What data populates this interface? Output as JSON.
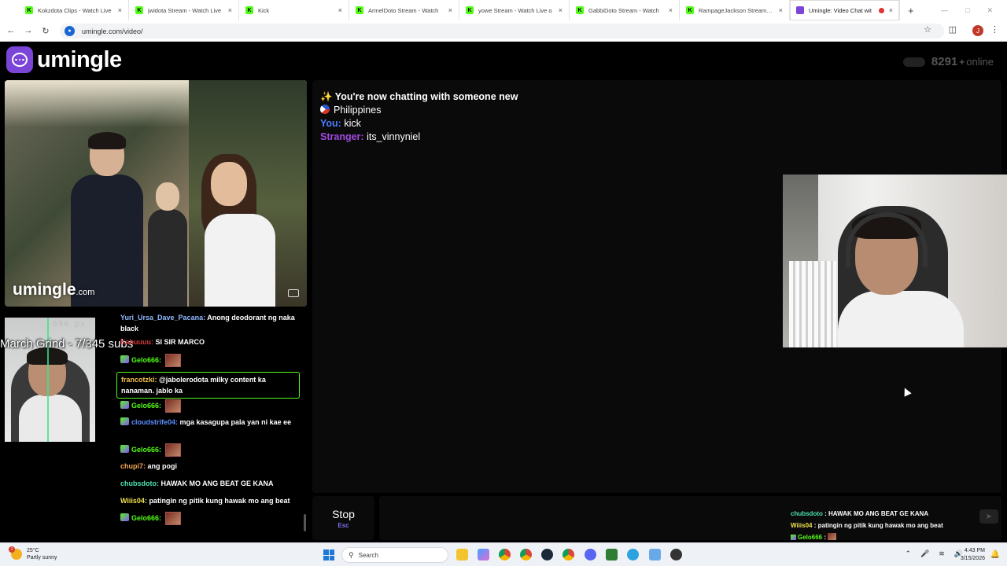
{
  "browser": {
    "tabs": [
      {
        "label": "Kokzdota Clips - Watch Live",
        "fav": "K",
        "type": "kick"
      },
      {
        "label": "jwidota Stream - Watch Live",
        "fav": "K",
        "type": "kick"
      },
      {
        "label": "Kick",
        "fav": "K",
        "type": "kick"
      },
      {
        "label": "ArmelDoto Stream - Watch",
        "fav": "K",
        "type": "kick"
      },
      {
        "label": "yowe Stream - Watch Live o",
        "fav": "K",
        "type": "kick"
      },
      {
        "label": "GabbiDoto Stream - Watch",
        "fav": "K",
        "type": "kick"
      },
      {
        "label": "RampageJackson Stream - W",
        "fav": "K",
        "type": "kick"
      },
      {
        "label": "Umingle: Video Chat wit",
        "fav": "",
        "type": "umingle",
        "active": true
      }
    ],
    "close_glyph": "×",
    "new_tab_glyph": "+",
    "url": "umingle.com/video/",
    "profile_initial": "J",
    "icons": [
      "back-icon",
      "forward-icon",
      "reload-icon",
      "site-info-icon",
      "star-icon",
      "extensions-icon",
      "kebab-menu-icon"
    ]
  },
  "site": {
    "name": "umingle",
    "online_count": "8291",
    "online_plus": "+",
    "online_label": "online",
    "watermark_main": "umingle",
    "watermark_suffix": ".com"
  },
  "overlay": {
    "px_label": "694 px",
    "grind_text": "March Grind - 7/345 subs"
  },
  "kick_chat": [
    {
      "user": "Yuri_Ursa_Dave_Pacana",
      "user_color": "#8fb8ff",
      "text": "Anong deodorant ng naka black",
      "emote": false,
      "badge": false
    },
    {
      "user": "Kabuuuu",
      "user_color": "#d13b3b",
      "text": "SI SIR MARCO",
      "emote": false,
      "badge": false
    },
    {
      "user": "Gelo666",
      "user_color": "#53fc18",
      "text": "",
      "emote": true,
      "badge": true
    },
    {
      "user": "francotzki",
      "user_color": "#f2c14e",
      "text": "@jabolerodota milky content ka nanaman. jablo ka",
      "emote": false,
      "badge": false,
      "highlight": true
    },
    {
      "user": "Gelo666",
      "user_color": "#53fc18",
      "text": "",
      "emote": true,
      "badge": true
    },
    {
      "user": "cloudstrife04",
      "user_color": "#5b8cff",
      "text": "mga kasagupa pala yan ni kae ee",
      "emote": false,
      "badge": true
    },
    {
      "user": "Gelo666",
      "user_color": "#53fc18",
      "text": "",
      "emote": true,
      "badge": true
    },
    {
      "user": "chupi7",
      "user_color": "#f2a654",
      "text": "ang pogi",
      "emote": false,
      "badge": false
    },
    {
      "user": "chubsdoto",
      "user_color": "#4ee0b0",
      "text": "HAWAK MO ANG BEAT GE KANA",
      "emote": false,
      "badge": false
    },
    {
      "user": "Wiiis04",
      "user_color": "#f2e14e",
      "text": "patingin ng pitik kung hawak mo ang beat",
      "emote": false,
      "badge": false
    },
    {
      "user": "Gelo666",
      "user_color": "#53fc18",
      "text": "",
      "emote": true,
      "badge": true
    }
  ],
  "chat": {
    "intro": "✨ You're now chatting with someone new",
    "country": "Philippines",
    "you_label": "You:",
    "you_text": "kick",
    "stranger_label": "Stranger:",
    "stranger_text": "its_vinnyniel"
  },
  "controls": {
    "stop_label": "Stop",
    "stop_hint": "Esc",
    "input_value": "",
    "input_placeholder": "",
    "send_glyph": "➤"
  },
  "mini_chat": [
    {
      "user": "chubsdoto",
      "user_color": "#4ee0b0",
      "text": "HAWAK MO ANG BEAT GE KANA"
    },
    {
      "user": "Wiiis04",
      "user_color": "#f2e14e",
      "text": "patingin ng pitik kung hawak mo ang beat"
    },
    {
      "user": "Gelo666",
      "user_color": "#53fc18",
      "text": ""
    }
  ],
  "taskbar": {
    "temp": "25°C",
    "condition": "Partly sunny",
    "weather_badge": "1",
    "search_label": "Search",
    "time": "4:43 PM",
    "date": "3/15/2026"
  }
}
